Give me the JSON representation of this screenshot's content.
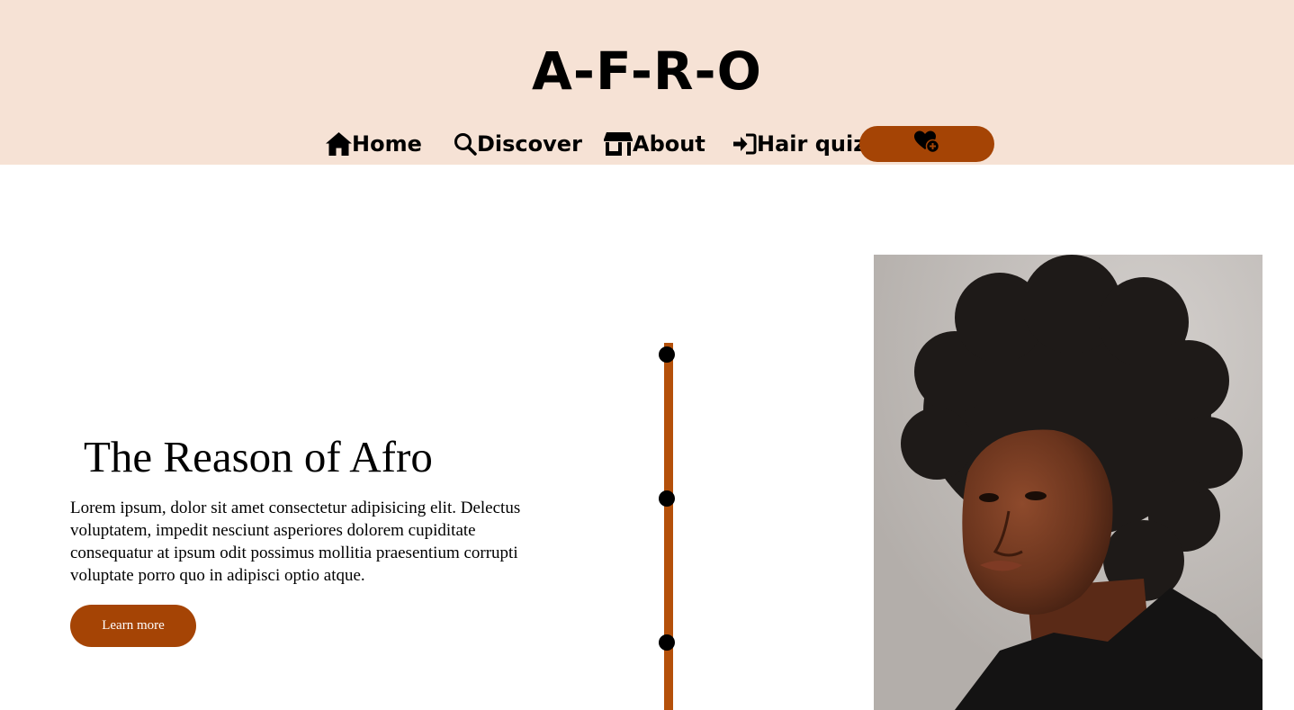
{
  "header": {
    "logo": "A-F-R-O",
    "nav": [
      {
        "label": "Home",
        "icon": "home-icon"
      },
      {
        "label": "Discover",
        "icon": "search-icon"
      },
      {
        "label": "About",
        "icon": "store-icon"
      },
      {
        "label": "Hair quiz",
        "icon": "sign-in-icon"
      }
    ],
    "favorites_icon": "heart-plus-icon"
  },
  "hero": {
    "title": "The Reason of Afro",
    "description": "Lorem ipsum, dolor sit amet consectetur adipisicing elit. Delectus voluptatem, impedit nesciunt asperiores dolorem cupiditate consequatur at ipsum odit possimus mollitia praesentium corrupti voluptate porro quo in adipisci optio atque.",
    "button_label": "Learn more"
  },
  "timeline": {
    "points": 3
  },
  "photo": {
    "subject": "portrait-photo"
  },
  "colors": {
    "header_bg": "#f6e2d5",
    "accent": "#a54405",
    "timeline": "#b4500a"
  }
}
